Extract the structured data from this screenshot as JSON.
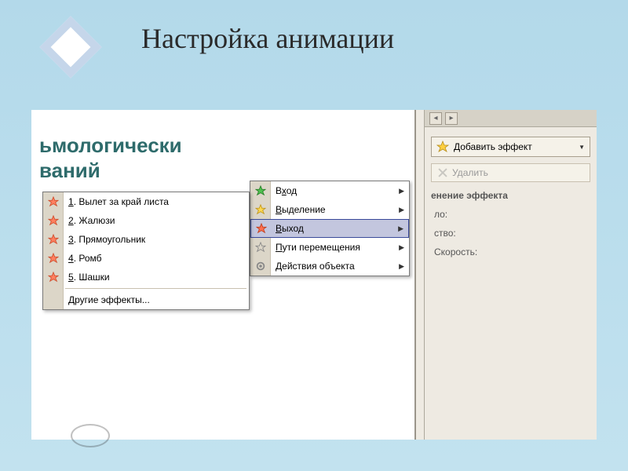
{
  "title": "Настройка анимации",
  "slide": {
    "line1": "ьмологически",
    "line2": "ваний"
  },
  "pane": {
    "add_effect": "Добавить эффект",
    "delete": "Удалить",
    "section": "енение эффекта",
    "field1": "ло:",
    "field2": "ство:",
    "field3": "Скорость:"
  },
  "menu_main": [
    {
      "icon": "star-green",
      "label": "Вход",
      "u": 1,
      "arrow": true
    },
    {
      "icon": "star-yellow",
      "label": "Выделение",
      "u": 0,
      "arrow": true
    },
    {
      "icon": "star-red",
      "label": "Выход",
      "u": 0,
      "arrow": true,
      "hover": true
    },
    {
      "icon": "star-outline",
      "label": "Пути перемещения",
      "u": 0,
      "arrow": true
    },
    {
      "icon": "gear",
      "label": "Действия объекта",
      "u": 0,
      "arrow": true
    }
  ],
  "menu_exit": [
    {
      "n": "1",
      "label": "Вылет за край листа"
    },
    {
      "n": "2",
      "label": "Жалюзи"
    },
    {
      "n": "3",
      "label": "Прямоугольник"
    },
    {
      "n": "4",
      "label": "Ромб"
    },
    {
      "n": "5",
      "label": "Шашки"
    }
  ],
  "menu_exit_footer": "Другие эффекты..."
}
